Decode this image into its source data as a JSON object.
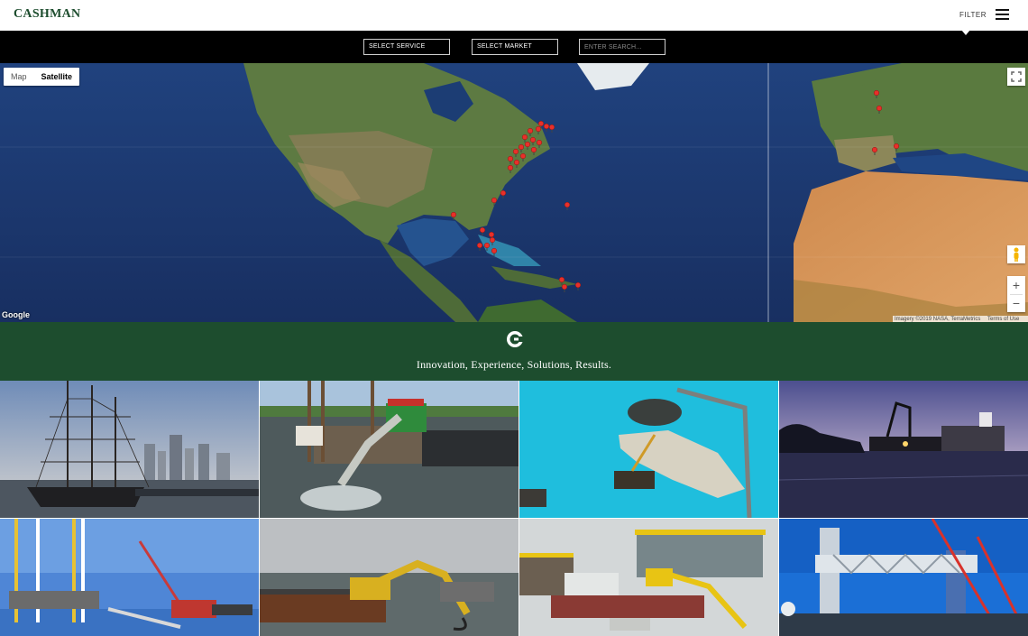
{
  "header": {
    "logo_text": "CASHMAN",
    "filter_label": "FILTER"
  },
  "filter_bar": {
    "service_label": "SELECT SERVICE",
    "market_label": "SELECT MARKET",
    "search_placeholder": "ENTER SEARCH..."
  },
  "map": {
    "type_options": [
      "Map",
      "Satellite"
    ],
    "active_type": "Satellite",
    "google_label": "Google",
    "attribution": "Imagery ©2019 NASA, TerraMetrics",
    "terms_label": "Terms of Use",
    "zoom_in": "+",
    "zoom_out": "−"
  },
  "band": {
    "tagline": "Innovation, Experience, Solutions, Results."
  },
  "colors": {
    "brand_green": "#1d4d2e",
    "marker_red": "#e8302a",
    "filter_bar": "#000000"
  },
  "gallery": {
    "tiles": [
      {
        "subject": "tall-ship-harbor-icon"
      },
      {
        "subject": "excavator-barge-icon"
      },
      {
        "subject": "island-dredging-icon"
      },
      {
        "subject": "dusk-barge-icon"
      },
      {
        "subject": "jackup-crane-icon"
      },
      {
        "subject": "excavator-river-icon"
      },
      {
        "subject": "barge-crane-icon"
      },
      {
        "subject": "bridge-construction-icon"
      }
    ]
  }
}
